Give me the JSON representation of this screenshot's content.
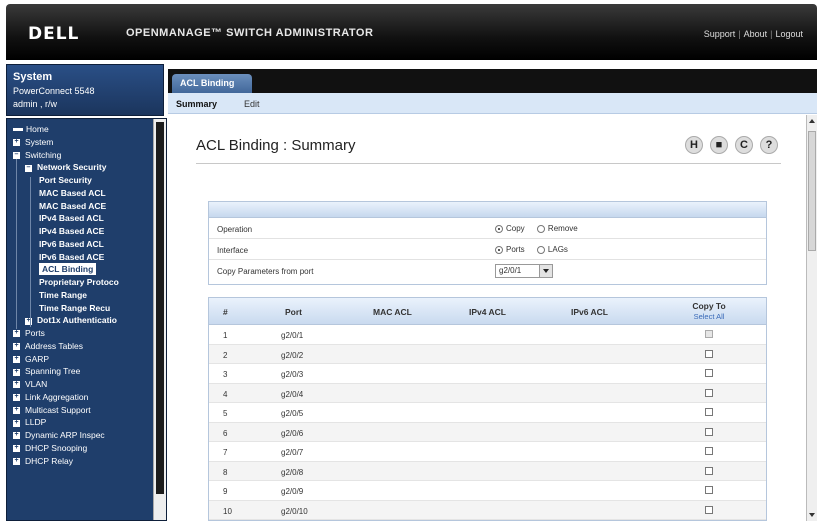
{
  "header": {
    "logo": "DELL",
    "product": "OPENMANAGE™ SWITCH ADMINISTRATOR",
    "links": [
      "Support",
      "About",
      "Logout"
    ]
  },
  "system": {
    "title": "System",
    "model": "PowerConnect 5548",
    "user": "admin , r/w"
  },
  "tree": {
    "items": [
      {
        "label": "Home",
        "level": 0,
        "icon": "home-icon"
      },
      {
        "label": "System",
        "level": 0,
        "icon": "plus-icon"
      },
      {
        "label": "Switching",
        "level": 0,
        "icon": "minus-icon"
      },
      {
        "label": "Network Security",
        "level": 1,
        "icon": "minus-icon"
      },
      {
        "label": "Port Security",
        "level": 2
      },
      {
        "label": "MAC Based ACL",
        "level": 2
      },
      {
        "label": "MAC Based ACE",
        "level": 2
      },
      {
        "label": "IPv4 Based ACL",
        "level": 2
      },
      {
        "label": "IPv4 Based ACE",
        "level": 2
      },
      {
        "label": "IPv6 Based ACL",
        "level": 2
      },
      {
        "label": "IPv6 Based ACE",
        "level": 2
      },
      {
        "label": "ACL Binding",
        "level": 2,
        "selected": true
      },
      {
        "label": "Proprietary Protoco",
        "level": 2
      },
      {
        "label": "Time Range",
        "level": 2
      },
      {
        "label": "Time Range Recu",
        "level": 2
      },
      {
        "label": "Dot1x Authenticatio",
        "level": 1,
        "icon": "plus-icon"
      },
      {
        "label": "Ports",
        "level": 0,
        "icon": "plus-icon"
      },
      {
        "label": "Address Tables",
        "level": 0,
        "icon": "plus-icon"
      },
      {
        "label": "GARP",
        "level": 0,
        "icon": "plus-icon"
      },
      {
        "label": "Spanning Tree",
        "level": 0,
        "icon": "plus-icon"
      },
      {
        "label": "VLAN",
        "level": 0,
        "icon": "plus-icon"
      },
      {
        "label": "Link Aggregation",
        "level": 0,
        "icon": "plus-icon"
      },
      {
        "label": "Multicast Support",
        "level": 0,
        "icon": "plus-icon"
      },
      {
        "label": "LLDP",
        "level": 0,
        "icon": "plus-icon"
      },
      {
        "label": "Dynamic ARP Inspec",
        "level": 0,
        "icon": "plus-icon"
      },
      {
        "label": "DHCP Snooping",
        "level": 0,
        "icon": "plus-icon"
      },
      {
        "label": "DHCP Relay",
        "level": 0,
        "icon": "plus-icon"
      }
    ]
  },
  "tabs": {
    "active": "ACL Binding",
    "subnav": [
      "Summary",
      "Edit"
    ]
  },
  "page": {
    "title": "ACL Binding : Summary",
    "tool_icons": [
      "save-icon",
      "print-icon",
      "refresh-icon",
      "help-icon"
    ]
  },
  "form": {
    "operation_label": "Operation",
    "operation_options": [
      "Copy",
      "Remove"
    ],
    "operation_selected": "Copy",
    "interface_label": "Interface",
    "interface_options": [
      "Ports",
      "LAGs"
    ],
    "interface_selected": "Ports",
    "copy_params_label": "Copy Parameters from port",
    "copy_params_value": "g2/0/1"
  },
  "table": {
    "columns": [
      "#",
      "Port",
      "MAC ACL",
      "IPv4 ACL",
      "IPv6 ACL",
      "Copy To"
    ],
    "select_all": "Select All",
    "rows": [
      {
        "num": "1",
        "port": "g2/0/1",
        "copy_disabled": true
      },
      {
        "num": "2",
        "port": "g2/0/2"
      },
      {
        "num": "3",
        "port": "g2/0/3"
      },
      {
        "num": "4",
        "port": "g2/0/4"
      },
      {
        "num": "5",
        "port": "g2/0/5"
      },
      {
        "num": "6",
        "port": "g2/0/6"
      },
      {
        "num": "7",
        "port": "g2/0/7"
      },
      {
        "num": "8",
        "port": "g2/0/8"
      },
      {
        "num": "9",
        "port": "g2/0/9"
      },
      {
        "num": "10",
        "port": "g2/0/10"
      }
    ]
  }
}
